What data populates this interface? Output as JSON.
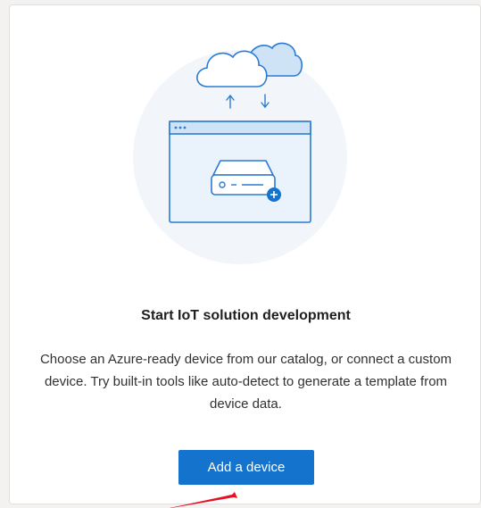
{
  "empty_state": {
    "title": "Start IoT solution development",
    "description": "Choose an Azure-ready device from our catalog, or connect a custom device. Try built-in tools like auto-detect to generate a template from device data.",
    "primary_action_label": "Add a device"
  },
  "illustration": {
    "icons": [
      "cloud-icon",
      "cloud-icon",
      "arrow-up-icon",
      "arrow-down-icon",
      "browser-window-icon",
      "device-icon",
      "add-badge-icon"
    ]
  },
  "colors": {
    "accent": "#1473cc",
    "illustration_blue": "#2b7bd3",
    "illustration_light": "#e8f2fb",
    "pointer_red": "#e81123"
  }
}
